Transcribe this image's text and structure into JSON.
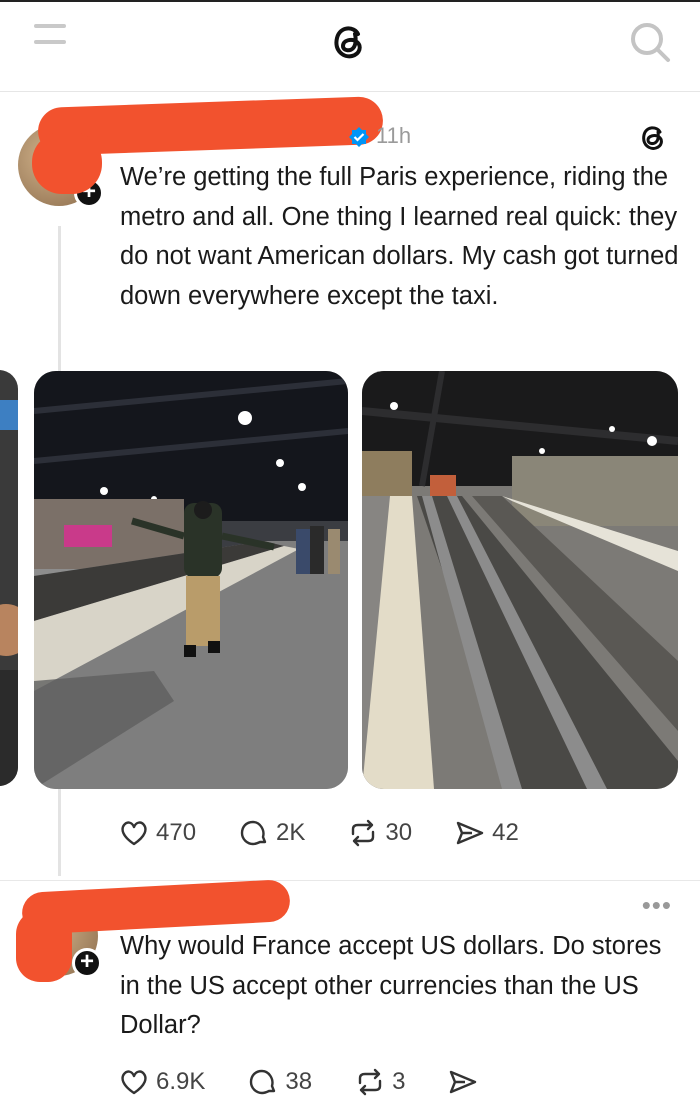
{
  "post1": {
    "time": "11h",
    "text": "We’re getting the full Paris experience, riding the metro and all. One thing I learned real quick: they do not want American dollars. My cash got turned down everywhere except the taxi.",
    "likes": "470",
    "replies": "2K",
    "reposts": "30",
    "shares": "42"
  },
  "post2": {
    "text": "Why would France accept US dollars. Do stores in the US accept other currencies than the US Dollar?",
    "likes": "6.9K",
    "replies": "38",
    "reposts": "3"
  },
  "colors": {
    "redaction": "#f2522e",
    "verified": "#0095f6"
  }
}
